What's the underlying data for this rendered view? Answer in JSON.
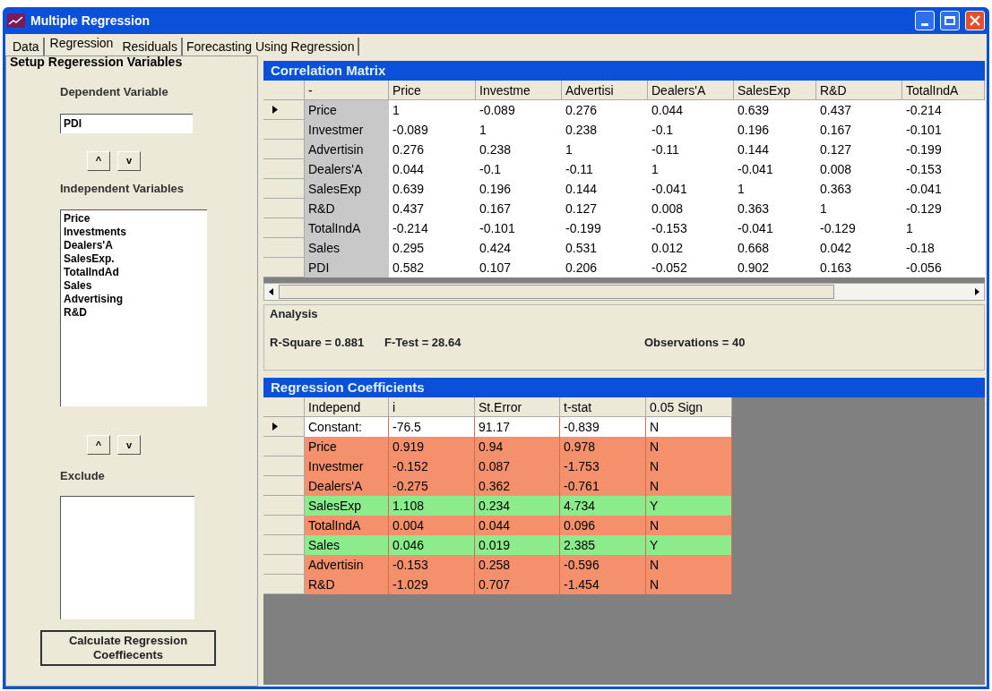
{
  "window": {
    "title": "Multiple Regression"
  },
  "tabs": [
    {
      "label": "Data",
      "selected": false
    },
    {
      "label": "Regression",
      "selected": true
    },
    {
      "label": "Residuals",
      "selected": false
    },
    {
      "label": "Forecasting Using Regression",
      "selected": false
    }
  ],
  "setup": {
    "title": "Setup Regeression Variables",
    "dependent_label": "Dependent Variable",
    "dependent_value": "PDI",
    "up_button": "^",
    "down_button": "v",
    "independent_label": "Independent Variables",
    "independent_items": [
      "Price",
      "Investments",
      "Dealers'A",
      "SalesExp.",
      "TotalIndAd",
      "Sales",
      "Advertising",
      "R&D"
    ],
    "up_button_2": "^",
    "down_button_2": "v",
    "exclude_label": "Exclude",
    "calculate_button": "Calculate Regression Coeffiecents"
  },
  "correlation": {
    "title": "Correlation Matrix",
    "columns": [
      "-",
      "Price",
      "Investme",
      "Advertisi",
      "Dealers'A",
      "SalesExp",
      "R&D",
      "TotalIndA"
    ],
    "rows": [
      {
        "selected": true,
        "cells": [
          "Price",
          "1",
          "-0.089",
          "0.276",
          "0.044",
          "0.639",
          "0.437",
          "-0.214"
        ]
      },
      {
        "selected": false,
        "cells": [
          "Investmer",
          "-0.089",
          "1",
          "0.238",
          "-0.1",
          "0.196",
          "0.167",
          "-0.101"
        ]
      },
      {
        "selected": false,
        "cells": [
          "Advertisin",
          "0.276",
          "0.238",
          "1",
          "-0.11",
          "0.144",
          "0.127",
          "-0.199"
        ]
      },
      {
        "selected": false,
        "cells": [
          "Dealers'A",
          "0.044",
          "-0.1",
          "-0.11",
          "1",
          "-0.041",
          "0.008",
          "-0.153"
        ]
      },
      {
        "selected": false,
        "cells": [
          "SalesExp",
          "0.639",
          "0.196",
          "0.144",
          "-0.041",
          "1",
          "0.363",
          "-0.041"
        ]
      },
      {
        "selected": false,
        "cells": [
          "R&D",
          "0.437",
          "0.167",
          "0.127",
          "0.008",
          "0.363",
          "1",
          "-0.129"
        ]
      },
      {
        "selected": false,
        "cells": [
          "TotalIndA",
          "-0.214",
          "-0.101",
          "-0.199",
          "-0.153",
          "-0.041",
          "-0.129",
          "1"
        ]
      },
      {
        "selected": false,
        "cells": [
          "Sales",
          "0.295",
          "0.424",
          "0.531",
          "0.012",
          "0.668",
          "0.042",
          "-0.18"
        ]
      },
      {
        "selected": false,
        "cells": [
          "PDI",
          "0.582",
          "0.107",
          "0.206",
          "-0.052",
          "0.902",
          "0.163",
          "-0.056"
        ]
      }
    ]
  },
  "analysis": {
    "title": "Analysis",
    "r_square": "R-Square = 0.881",
    "f_test": "F-Test = 28.64",
    "observations": "Observations = 40"
  },
  "coefficients": {
    "title": "Regression Coefficients",
    "columns": [
      "Independ",
      "i",
      "St.Error",
      "t-stat",
      "0.05 Sign"
    ],
    "rows": [
      {
        "selected": true,
        "color": "#ffffff",
        "cells": [
          "Constant:",
          "-76.5",
          "91.17",
          "-0.839",
          "N"
        ]
      },
      {
        "selected": false,
        "color": "#f4906c",
        "cells": [
          "Price",
          "0.919",
          "0.94",
          "0.978",
          "N"
        ]
      },
      {
        "selected": false,
        "color": "#f4906c",
        "cells": [
          "Investmer",
          "-0.152",
          "0.087",
          "-1.753",
          "N"
        ]
      },
      {
        "selected": false,
        "color": "#f4906c",
        "cells": [
          "Dealers'A",
          "-0.275",
          "0.362",
          "-0.761",
          "N"
        ]
      },
      {
        "selected": false,
        "color": "#8cec8c",
        "cells": [
          "SalesExp",
          "1.108",
          "0.234",
          "4.734",
          "Y"
        ]
      },
      {
        "selected": false,
        "color": "#f4906c",
        "cells": [
          "TotalIndA",
          "0.004",
          "0.044",
          "0.096",
          "N"
        ]
      },
      {
        "selected": false,
        "color": "#8cec8c",
        "cells": [
          "Sales",
          "0.046",
          "0.019",
          "2.385",
          "Y"
        ]
      },
      {
        "selected": false,
        "color": "#f4906c",
        "cells": [
          "Advertisin",
          "-0.153",
          "0.258",
          "-0.596",
          "N"
        ]
      },
      {
        "selected": false,
        "color": "#f4906c",
        "cells": [
          "R&D",
          "-1.029",
          "0.707",
          "-1.454",
          "N"
        ]
      }
    ]
  }
}
